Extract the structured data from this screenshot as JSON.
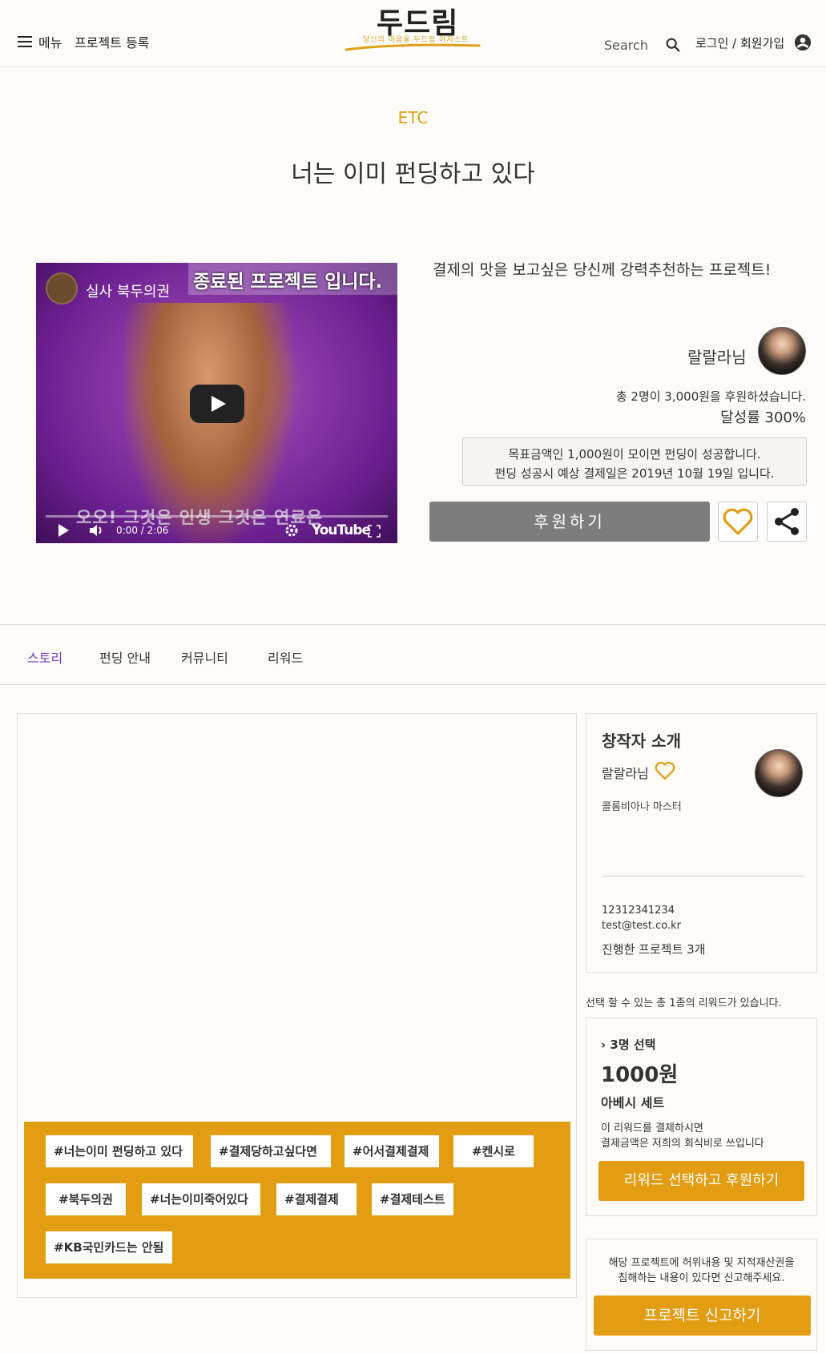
{
  "header": {
    "menu_label": "메뉴",
    "register_label": "프로젝트 등록",
    "logo_title": "두드림",
    "logo_subtitle": "당신의 마음을 두드림 아지스트",
    "search_label": "Search",
    "login_label": "로그인 / 회원가입",
    "accent_color": "#e0a017"
  },
  "project": {
    "category": "ETC",
    "title": "너는 이미 펀딩하고 있다",
    "tagline": "결제의 맛을 보고싶은 당신께 강력추천하는 프로젝트!",
    "creator_name": "랄랄라님",
    "support_summary": "총 2명이 3,000원을 후원하셨습니다.",
    "achievement": "달성률 300%",
    "notice_line1": "목표금액인 1,000원이 모이면 펀딩이 성공합니다.",
    "notice_line2": "펀딩 성공시 예상 결제일은 2019년 10월 19일 입니다.",
    "support_button": "후원하기"
  },
  "video": {
    "channel_name": "실사 북두의권",
    "ended_banner": "종료된 프로젝트 입니다.",
    "subtitle": "오오! 그것은 인생 그것은 연료은",
    "time": "0:00 / 2:06",
    "platform": "YouTube"
  },
  "tabs": [
    {
      "label": "스토리",
      "active": true
    },
    {
      "label": "펀딩 안내",
      "active": false
    },
    {
      "label": "커뮤니티",
      "active": false
    },
    {
      "label": "리워드",
      "active": false
    }
  ],
  "tags": [
    "#너는이미 펀딩하고 있다",
    "#결제당하고싶다면",
    "#어서결제결제",
    "#켄시로",
    "#북두의권",
    "#너는이미죽어있다",
    "#결제결제",
    "#결제테스트",
    "#KB국민카드는 안됨"
  ],
  "creator_card": {
    "title": "창작자 소개",
    "name": "랄랄라님",
    "role": "콜롬비아나 마스터",
    "phone": "12312341234",
    "email": "test@test.co.kr",
    "projects": "진행한 프로젝트 3개"
  },
  "rewards": {
    "count_text": "선택 할 수 있는 총 1종의 리워드가 있습니다.",
    "items": [
      {
        "count": "3명 선택",
        "price": "1000원",
        "name": "아베시 세트",
        "desc_line1": "이 리워드를 결제하시면",
        "desc_line2": "결제금액은 저희의 회식비로 쓰입니다",
        "button": "리워드 선택하고 후원하기"
      }
    ]
  },
  "report": {
    "line1": "해당 프로젝트에 허위내용 및 지적재산권을",
    "line2": "침해하는 내용이 있다면 신고해주세요.",
    "button": "프로젝트 신고하기"
  }
}
